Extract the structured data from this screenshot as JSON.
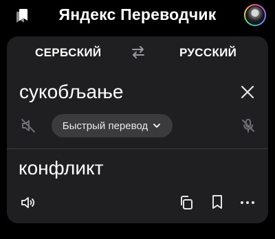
{
  "header": {
    "title": "Яндекс Переводчик",
    "bookmarks_icon": "bookmarks-icon",
    "avatar_icon": "user-avatar"
  },
  "languages": {
    "source": "СЕРБСКИЙ",
    "target": "РУССКИЙ",
    "swap_icon": "swap-arrows-icon"
  },
  "input": {
    "text": "сукобљање",
    "clear_icon": "close-icon",
    "mute_icon": "speaker-muted-icon",
    "mic_icon": "mic-off-icon"
  },
  "mode": {
    "label": "Быстрый перевод",
    "chevron_icon": "chevron-down-icon"
  },
  "output": {
    "text": "конфликт",
    "speaker_icon": "speaker-icon",
    "copy_icon": "copy-icon",
    "save_icon": "bookmark-icon",
    "more_icon": "more-dots-icon"
  },
  "colors": {
    "background": "#000000",
    "card": "#1f1f21",
    "pill": "#3b3b3e",
    "icon_dim": "#8e8e93",
    "text": "#ffffff"
  }
}
